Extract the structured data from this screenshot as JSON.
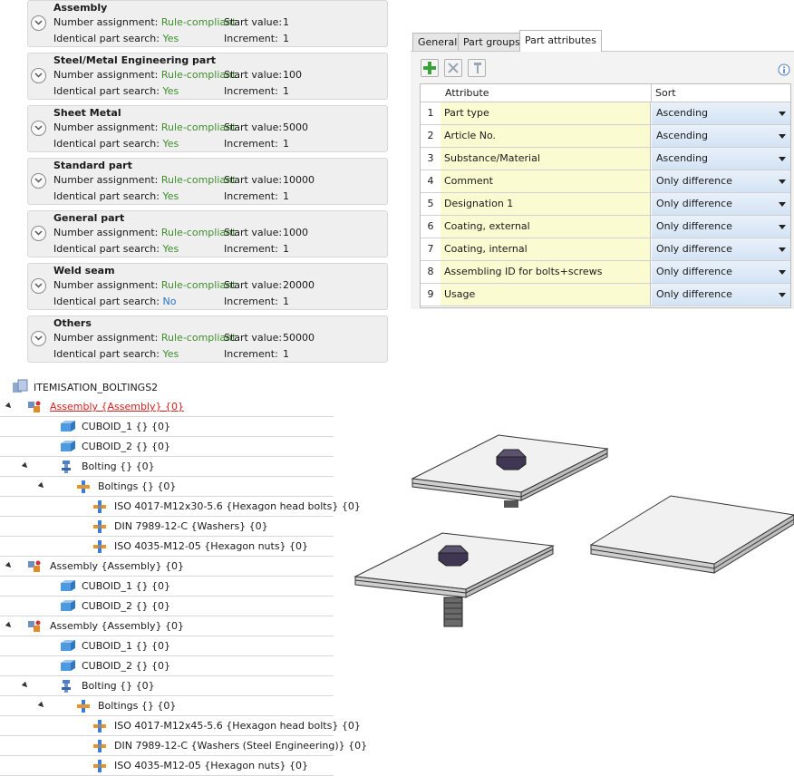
{
  "categories": [
    {
      "title": "Assembly",
      "number_label": "Number assignment:",
      "number_value": "Rule-compliant",
      "start_label": "Start value:",
      "start_value": "1",
      "search_label": "Identical part search:",
      "search_value": "Yes",
      "inc_label": "Increment:",
      "inc_value": "1"
    },
    {
      "title": "Steel/Metal Engineering part",
      "number_label": "Number assignment:",
      "number_value": "Rule-compliant",
      "start_label": "Start value:",
      "start_value": "100",
      "search_label": "Identical part search:",
      "search_value": "Yes",
      "inc_label": "Increment:",
      "inc_value": "1"
    },
    {
      "title": "Sheet Metal",
      "number_label": "Number assignment:",
      "number_value": "Rule-compliant",
      "start_label": "Start value:",
      "start_value": "5000",
      "search_label": "Identical part search:",
      "search_value": "Yes",
      "inc_label": "Increment:",
      "inc_value": "1"
    },
    {
      "title": "Standard part",
      "number_label": "Number assignment:",
      "number_value": "Rule-compliant",
      "start_label": "Start value:",
      "start_value": "10000",
      "search_label": "Identical part search:",
      "search_value": "Yes",
      "inc_label": "Increment:",
      "inc_value": "1"
    },
    {
      "title": "General part",
      "number_label": "Number assignment:",
      "number_value": "Rule-compliant",
      "start_label": "Start value:",
      "start_value": "1000",
      "search_label": "Identical part search:",
      "search_value": "Yes",
      "inc_label": "Increment:",
      "inc_value": "1"
    },
    {
      "title": "Weld seam",
      "number_label": "Number assignment:",
      "number_value": "Rule-compliant",
      "start_label": "Start value:",
      "start_value": "20000",
      "search_label": "Identical part search:",
      "search_value": "No",
      "inc_label": "Increment:",
      "inc_value": "1"
    },
    {
      "title": "Others",
      "number_label": "Number assignment:",
      "number_value": "Rule-compliant",
      "start_label": "Start value:",
      "start_value": "50000",
      "search_label": "Identical part search:",
      "search_value": "Yes",
      "inc_label": "Increment:",
      "inc_value": "1"
    }
  ],
  "tabs": [
    "General",
    "Part groups",
    "Part attributes"
  ],
  "active_tab": "Part attributes",
  "toolbar": {
    "add_icon": "add-plus-icon",
    "delete_icon": "delete-x-icon",
    "edit_icon": "pin-icon",
    "info_icon": "info-icon"
  },
  "grid": {
    "col_attribute": "Attribute",
    "col_sort": "Sort",
    "rows": [
      {
        "num": "1",
        "attribute": "Part type",
        "sort": "Ascending"
      },
      {
        "num": "2",
        "attribute": "Article No.",
        "sort": "Ascending"
      },
      {
        "num": "3",
        "attribute": "Substance/Material",
        "sort": "Ascending"
      },
      {
        "num": "4",
        "attribute": "Comment",
        "sort": "Only difference"
      },
      {
        "num": "5",
        "attribute": "Designation 1",
        "sort": "Only difference"
      },
      {
        "num": "6",
        "attribute": "Coating, external",
        "sort": "Only difference"
      },
      {
        "num": "7",
        "attribute": "Coating, internal",
        "sort": "Only difference"
      },
      {
        "num": "8",
        "attribute": "Assembling ID for bolts+screws",
        "sort": "Only difference"
      },
      {
        "num": "9",
        "attribute": "Usage",
        "sort": "Only difference"
      }
    ]
  },
  "tree": {
    "root": "ITEMISATION_BOLTINGS2",
    "nodes": [
      {
        "label": "Assembly {Assembly} {0}",
        "icon": "assembly-icon",
        "expanded": true,
        "highlight": true
      },
      {
        "label": "CUBOID_1 {} {0}",
        "icon": "cuboid-icon"
      },
      {
        "label": "CUBOID_2 {} {0}",
        "icon": "cuboid-icon"
      },
      {
        "label": "Bolting {} {0}",
        "icon": "bolting-icon",
        "expanded": true
      },
      {
        "label": "Boltings {} {0}",
        "icon": "boltings-icon",
        "expanded": true
      },
      {
        "label": "ISO 4017-M12x30-5.6 {Hexagon head bolts} {0}",
        "icon": "standard-part-icon"
      },
      {
        "label": "DIN 7989-12-C {Washers} {0}",
        "icon": "standard-part-icon"
      },
      {
        "label": "ISO 4035-M12-05 {Hexagon nuts} {0}",
        "icon": "standard-part-icon"
      },
      {
        "label": "Assembly {Assembly} {0}",
        "icon": "assembly-icon",
        "expanded": true
      },
      {
        "label": "CUBOID_1 {} {0}",
        "icon": "cuboid-icon"
      },
      {
        "label": "CUBOID_2 {} {0}",
        "icon": "cuboid-icon"
      },
      {
        "label": "Assembly {Assembly} {0}",
        "icon": "assembly-icon",
        "expanded": true
      },
      {
        "label": "CUBOID_1 {} {0}",
        "icon": "cuboid-icon"
      },
      {
        "label": "CUBOID_2 {} {0}",
        "icon": "cuboid-icon"
      },
      {
        "label": "Bolting {} {0}",
        "icon": "bolting-icon",
        "expanded": true
      },
      {
        "label": "Boltings {} {0}",
        "icon": "boltings-icon",
        "expanded": true
      },
      {
        "label": "ISO 4017-M12x45-5.6 {Hexagon head bolts} {0}",
        "icon": "standard-part-icon"
      },
      {
        "label": "DIN 7989-12-C {Washers (Steel Engineering)} {0}",
        "icon": "standard-part-icon"
      },
      {
        "label": "ISO 4035-M12-05 {Hexagon nuts} {0}",
        "icon": "standard-part-icon"
      }
    ]
  },
  "colors": {
    "green": "#3f8e2e",
    "blue": "#2a72c8",
    "highlight_red": "#d62020",
    "attr_bg": "#fbfbd2"
  }
}
